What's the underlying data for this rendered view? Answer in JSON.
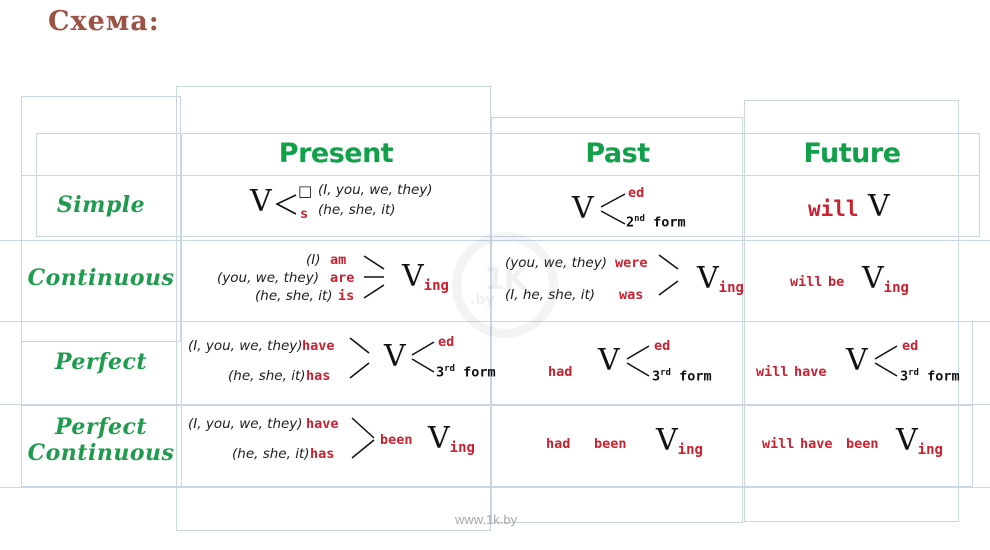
{
  "title": "Схема:",
  "colors": {
    "heading_green": "#12a04a",
    "label_green": "#1f9b4e",
    "aux_red": "#cc2030",
    "title_brown": "#9c5245",
    "grid": "#c9d6e4"
  },
  "table": {
    "corner_label": "",
    "columns": [
      {
        "label": "Present"
      },
      {
        "label": "Past"
      },
      {
        "label": "Future"
      }
    ],
    "rows": [
      {
        "label": "Simple"
      },
      {
        "label": "Continuous"
      },
      {
        "label": "Perfect"
      },
      {
        "label": "Perfect\nContinuous"
      }
    ]
  },
  "cells": {
    "present_simple": {
      "verb": "V",
      "branch_top": "□",
      "branch_bottom": "s",
      "note_top": "(I, you, we, they)",
      "note_bottom": "(he, she, it)"
    },
    "past_simple": {
      "verb": "V",
      "branch_top": "ed",
      "branch_bottom_num": "2",
      "branch_bottom_sup": "nd",
      "branch_bottom_word": "form"
    },
    "future_simple": {
      "aux": "will",
      "verb": "V"
    },
    "present_continuous": {
      "pron1": "(I)",
      "aux1": "am",
      "pron2": "(you, we, they)",
      "aux2": "are",
      "pron3": "(he, she, it)",
      "aux3": "is",
      "verb": "V",
      "verb_sub": "ing"
    },
    "past_continuous": {
      "pron1": "(you, we, they)",
      "aux1": "were",
      "pron2": "(I, he, she, it)",
      "aux2": "was",
      "verb": "V",
      "verb_sub": "ing"
    },
    "future_continuous": {
      "aux1": "will",
      "aux2": "be",
      "verb": "V",
      "verb_sub": "ing"
    },
    "present_perfect": {
      "pron1": "(I, you, we, they)",
      "aux1": "have",
      "pron2": "(he, she, it)",
      "aux2": "has",
      "verb": "V",
      "branch_top": "ed",
      "branch_bottom_num": "3",
      "branch_bottom_sup": "rd",
      "branch_bottom_word": "form"
    },
    "past_perfect": {
      "aux1": "had",
      "verb": "V",
      "branch_top": "ed",
      "branch_bottom_num": "3",
      "branch_bottom_sup": "rd",
      "branch_bottom_word": "form"
    },
    "future_perfect": {
      "aux1": "will",
      "aux2": "have",
      "verb": "V",
      "branch_top": "ed",
      "branch_bottom_num": "3",
      "branch_bottom_sup": "rd",
      "branch_bottom_word": "form"
    },
    "present_perfect_continuous": {
      "pron1": "(I, you, we, they)",
      "aux1": "have",
      "pron2": "(he, she, it)",
      "aux2": "has",
      "aux3": "been",
      "verb": "V",
      "verb_sub": "ing"
    },
    "past_perfect_continuous": {
      "aux1": "had",
      "aux2": "been",
      "verb": "V",
      "verb_sub": "ing"
    },
    "future_perfect_continuous": {
      "aux1": "will",
      "aux2": "have",
      "aux3": "been",
      "verb": "V",
      "verb_sub": "ing"
    }
  },
  "watermark": {
    "mark": "1K",
    "sub": ".by",
    "footer": "www.1k.by"
  }
}
